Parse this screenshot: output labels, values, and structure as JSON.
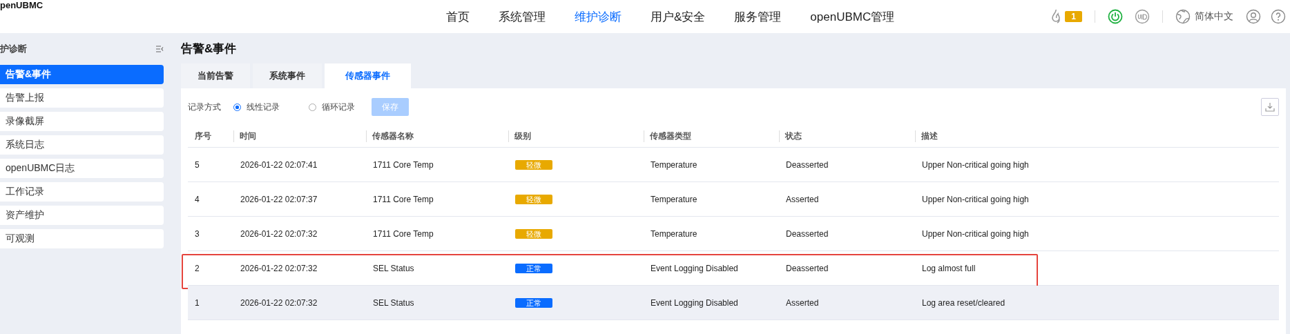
{
  "logo": "penUBMC",
  "nav": [
    {
      "label": "首页",
      "selected": false
    },
    {
      "label": "系统管理",
      "selected": false
    },
    {
      "label": "维护诊断",
      "selected": true
    },
    {
      "label": "用户&安全",
      "selected": false
    },
    {
      "label": "服务管理",
      "selected": false
    },
    {
      "label": "openUBMC管理",
      "selected": false
    }
  ],
  "header_tools": {
    "alarm_count": "1",
    "language": "简体中文"
  },
  "sidebar": {
    "title": "护诊断",
    "items": [
      {
        "label": "告警&事件",
        "selected": true
      },
      {
        "label": "告警上报",
        "selected": false
      },
      {
        "label": "录像截屏",
        "selected": false
      },
      {
        "label": "系统日志",
        "selected": false
      },
      {
        "label": "openUBMC日志",
        "selected": false
      },
      {
        "label": "工作记录",
        "selected": false
      },
      {
        "label": "资产维护",
        "selected": false
      },
      {
        "label": "可观测",
        "selected": false
      }
    ]
  },
  "page_title": "告警&事件",
  "tabs": [
    {
      "label": "当前告警",
      "selected": false
    },
    {
      "label": "系统事件",
      "selected": false
    },
    {
      "label": "传感器事件",
      "selected": true
    }
  ],
  "record_mode": {
    "label": "记录方式",
    "options": [
      {
        "label": "线性记录",
        "selected": true
      },
      {
        "label": "循环记录",
        "selected": false
      }
    ],
    "save_button": {
      "label": "保存",
      "disabled": true
    }
  },
  "table": {
    "columns": [
      "序号",
      "时间",
      "传感器名称",
      "级别",
      "传感器类型",
      "状态",
      "描述"
    ],
    "rows": [
      {
        "cells": [
          "5",
          "2026-01-22 02:07:41",
          "1711 Core Temp",
          "轻微",
          "Temperature",
          "Deasserted",
          "Upper Non-critical going high"
        ],
        "color": "#e8a900",
        "highlighted": false,
        "hovered": false
      },
      {
        "cells": [
          "4",
          "2026-01-22 02:07:37",
          "1711 Core Temp",
          "轻微",
          "Temperature",
          "Asserted",
          "Upper Non-critical going high"
        ],
        "color": "#e8a900",
        "highlighted": false,
        "hovered": false
      },
      {
        "cells": [
          "3",
          "2026-01-22 02:07:32",
          "1711 Core Temp",
          "轻微",
          "Temperature",
          "Deasserted",
          "Upper Non-critical going high"
        ],
        "color": "#e8a900",
        "highlighted": false,
        "hovered": false
      },
      {
        "cells": [
          "2",
          "2026-01-22 02:07:32",
          "SEL Status",
          "正常",
          "Event Logging Disabled",
          "Deasserted",
          "Log almost full"
        ],
        "color": "#0a6cff",
        "highlighted": true,
        "hovered": false
      },
      {
        "cells": [
          "1",
          "2026-01-22 02:07:32",
          "SEL Status",
          "正常",
          "Event Logging Disabled",
          "Asserted",
          "Log area reset/cleared"
        ],
        "color": "#0a6cff",
        "highlighted": false,
        "hovered": true
      }
    ]
  }
}
